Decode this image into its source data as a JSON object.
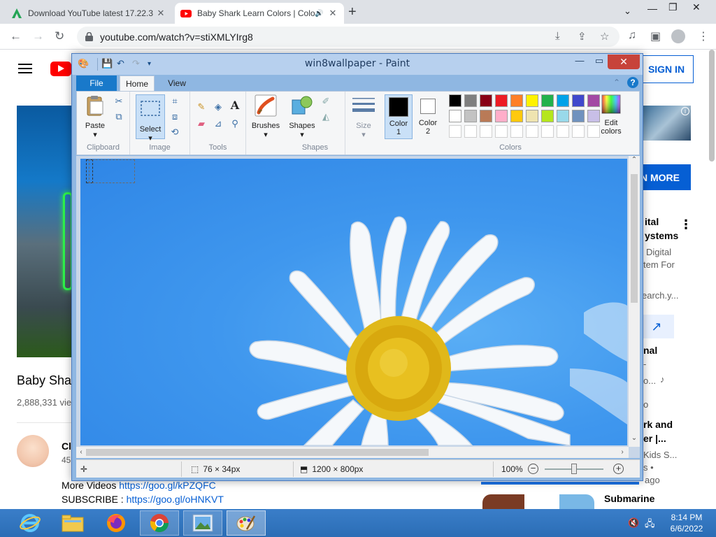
{
  "browser": {
    "tabs": [
      {
        "title": "Download YouTube latest 17.22.3",
        "active": false
      },
      {
        "title": "Baby Shark Learn Colors | Colors",
        "active": true
      }
    ],
    "new_tab": "+",
    "url": "youtube.com/watch?v=stiXMLYIrg8",
    "window_controls": {
      "dropdown": "⌄",
      "minimize": "—",
      "restore": "❐",
      "close": "✕"
    }
  },
  "youtube": {
    "sign_in": "SIGN IN",
    "video_title": "Baby Shar",
    "views": "2,888,331 vie",
    "channel": "Cl",
    "subscribers": "45",
    "description": [
      {
        "prefix": "More Videos ",
        "link": "https://goo.gl/kPZQFC"
      },
      {
        "prefix": "SUBSCRIBE : ",
        "link": "https://goo.gl/oHNKVT"
      }
    ],
    "learn_more": "N MORE",
    "sidebar": {
      "ad_title_1": "ital",
      "ad_title_2": "ystems",
      "ad_desc_1": "Digital",
      "ad_desc_2": "tem For",
      "ad_url": "earch.y...",
      "rec1_title": "nal",
      "rec1_line2": "-",
      "rec1_line3": "o...",
      "rec1_line4": "o",
      "rec2_title_1": "rk and",
      "rec2_title_2": "er |...",
      "rec2_meta_1": "Kids S...",
      "rec2_meta_2": "s •",
      "rec2_meta_3": "ago",
      "rec3_title": "Submarine"
    }
  },
  "paint": {
    "title": "win8wallpaper - Paint",
    "tabs": {
      "file": "File",
      "home": "Home",
      "view": "View"
    },
    "groups": {
      "clipboard": "Clipboard",
      "image": "Image",
      "tools": "Tools",
      "shapes": "Shapes",
      "colors": "Colors"
    },
    "buttons": {
      "paste": "Paste",
      "select": "Select",
      "brushes": "Brushes",
      "shapes": "Shapes",
      "size": "Size",
      "color1_line1": "Color",
      "color1_line2": "1",
      "color2_line1": "Color",
      "color2_line2": "2",
      "edit_colors_line1": "Edit",
      "edit_colors_line2": "colors"
    },
    "color1": "#000000",
    "color2": "#ffffff",
    "palette_row1": [
      "#000000",
      "#7f7f7f",
      "#880015",
      "#ed1c24",
      "#ff7f27",
      "#fff200",
      "#22b14c",
      "#00a2e8",
      "#3f48cc",
      "#a349a4"
    ],
    "palette_row2": [
      "#ffffff",
      "#c3c3c3",
      "#b97a57",
      "#ffaec9",
      "#ffc90e",
      "#efe4b0",
      "#b5e61d",
      "#99d9ea",
      "#7092be",
      "#c8bfe7"
    ],
    "status": {
      "selection_size": "76 × 34px",
      "image_size": "1200 × 800px",
      "zoom": "100%"
    }
  },
  "taskbar": {
    "time": "8:14 PM",
    "date": "6/6/2022"
  }
}
